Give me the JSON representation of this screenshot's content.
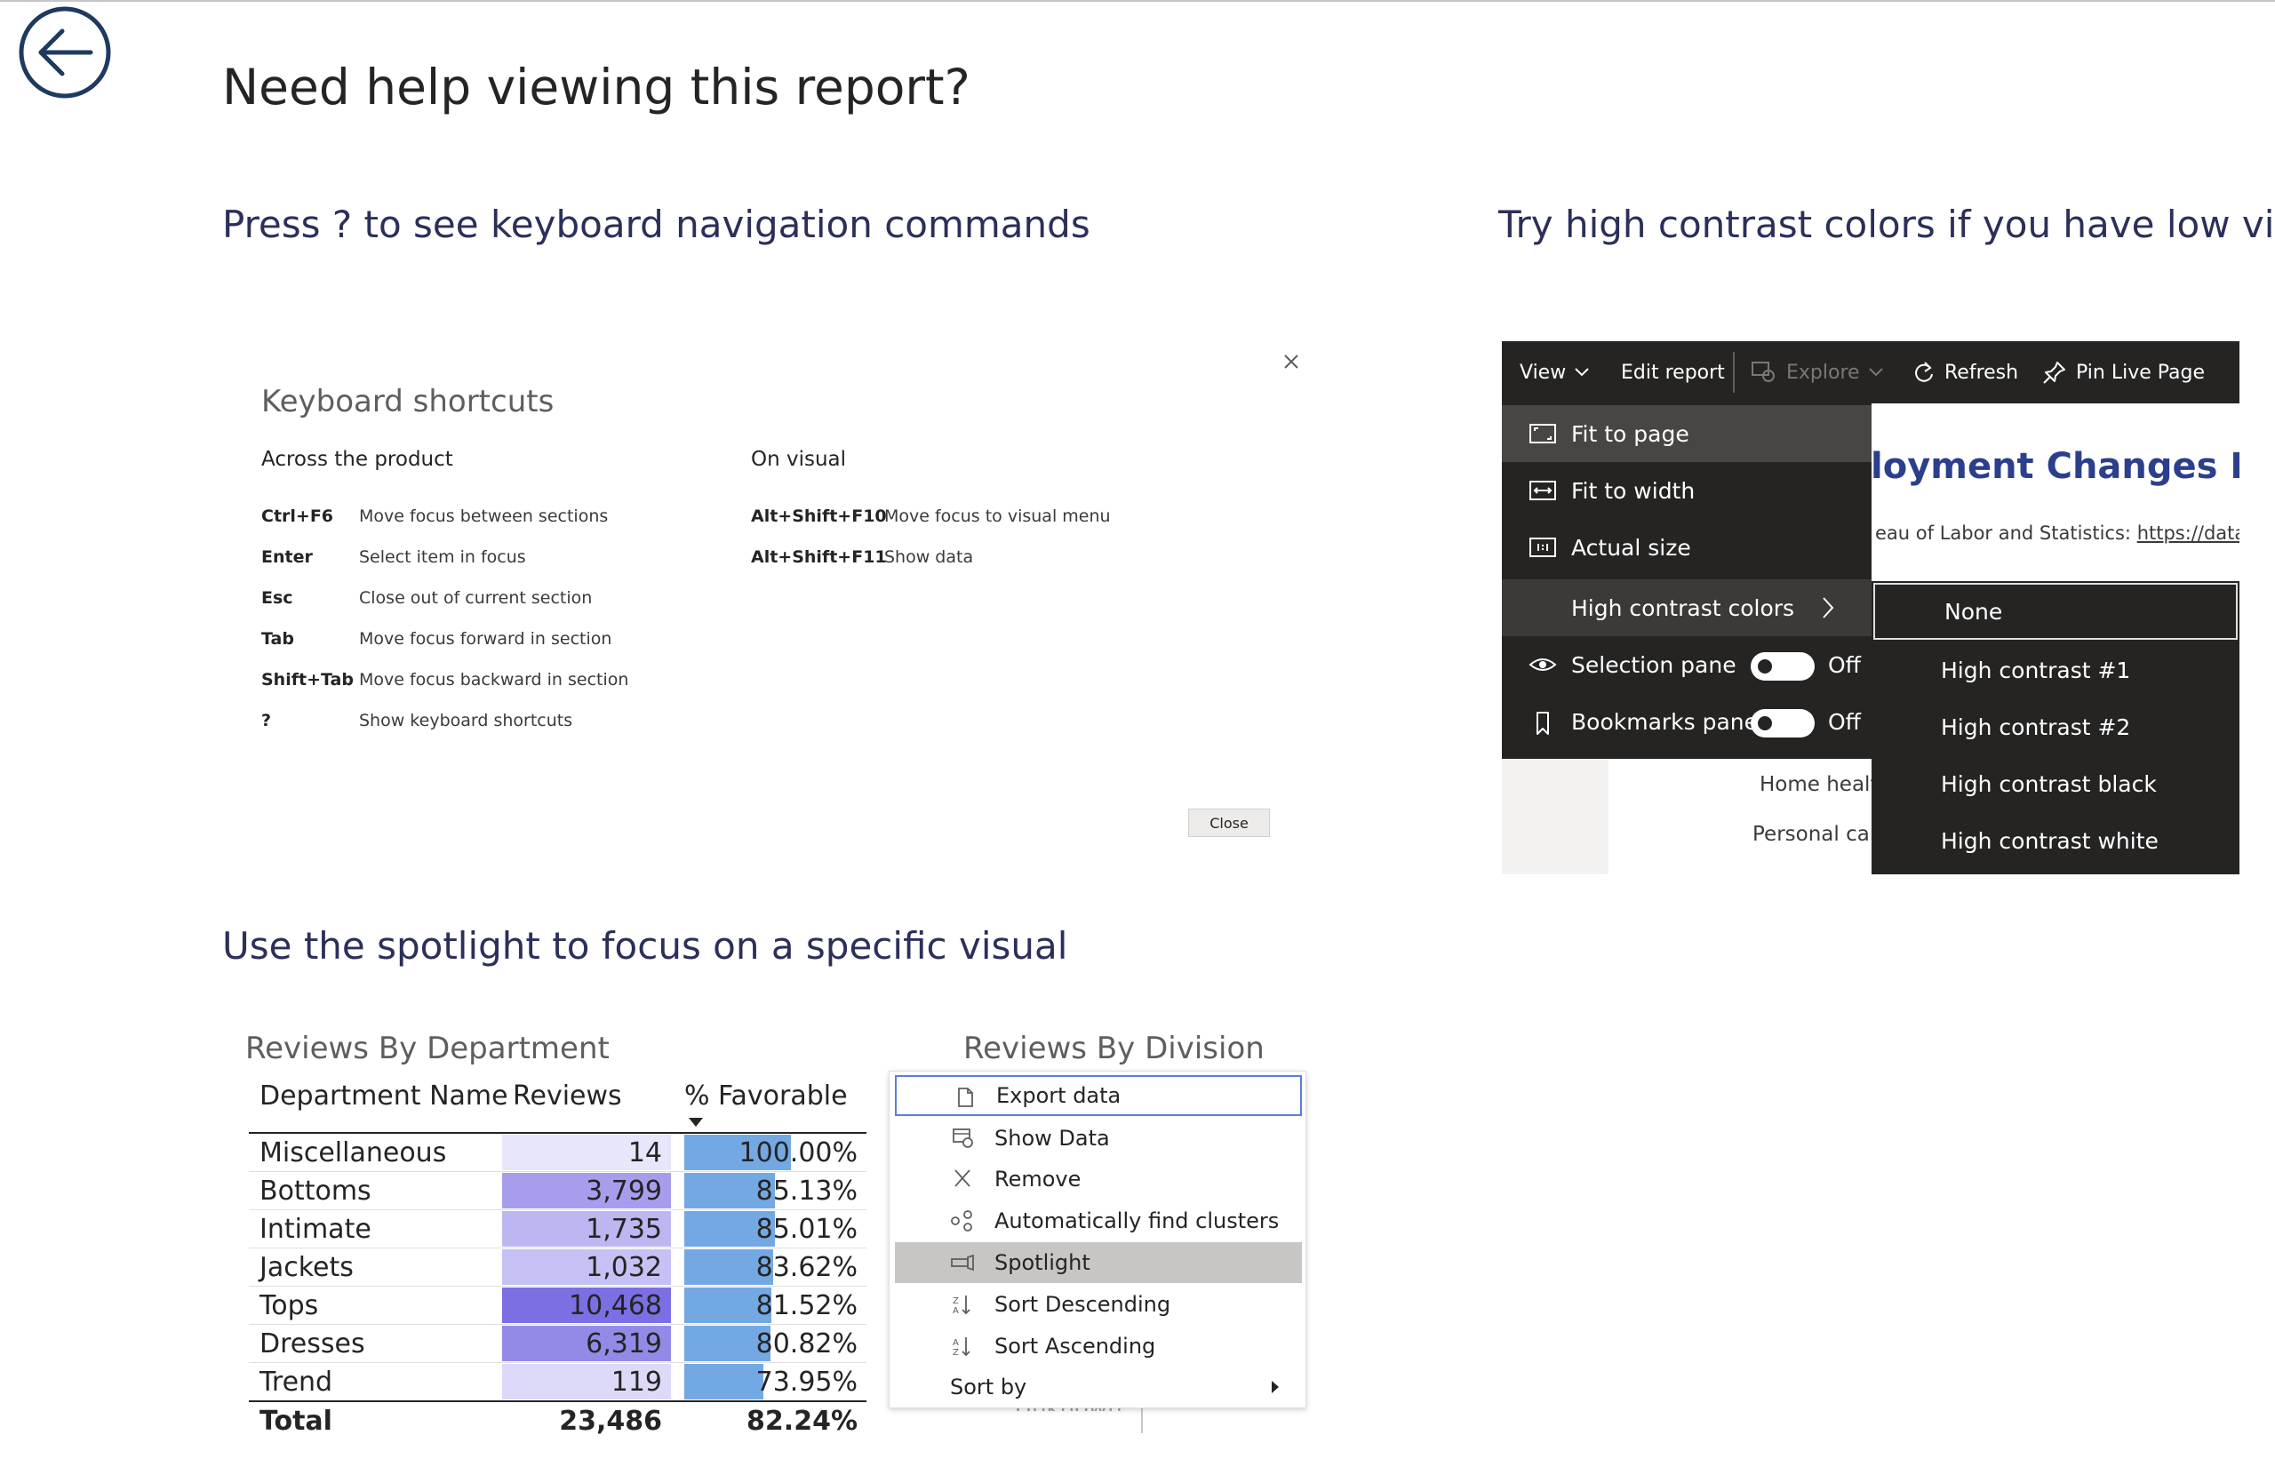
{
  "page": {
    "title": "Need help viewing this report?"
  },
  "sections": {
    "keyboard": "Press ? to see keyboard navigation commands",
    "contrast": "Try high contrast colors if you have low vision",
    "spotlight": "Use the spotlight to focus on a specific visual"
  },
  "keyboard_dialog": {
    "title": "Keyboard shortcuts",
    "col1_heading": "Across the product",
    "col2_heading": "On visual",
    "col1_rows": [
      {
        "key": "Ctrl+F6",
        "desc": "Move focus between sections"
      },
      {
        "key": "Enter",
        "desc": "Select item in focus"
      },
      {
        "key": "Esc",
        "desc": "Close out of current section"
      },
      {
        "key": "Tab",
        "desc": "Move focus forward in section"
      },
      {
        "key": "Shift+Tab",
        "desc": "Move focus backward in section"
      },
      {
        "key": "?",
        "desc": "Show keyboard shortcuts"
      }
    ],
    "col2_rows": [
      {
        "key": "Alt+Shift+F10",
        "desc": "Move focus to visual menu"
      },
      {
        "key": "Alt+Shift+F11",
        "desc": "Show data"
      }
    ],
    "close_label": "Close"
  },
  "contrast_demo": {
    "toolbar": {
      "view": "View",
      "edit_report": "Edit report",
      "explore": "Explore",
      "refresh": "Refresh",
      "pin": "Pin Live Page"
    },
    "report_title": "loyment Changes By (",
    "report_source_prefix": "eau of Labor and Statistics:",
    "report_source_link": "https://data",
    "report_rows": [
      "Home healt",
      "Personal car"
    ],
    "menu": {
      "fit_to_page": "Fit to page",
      "fit_to_width": "Fit to width",
      "actual_size": "Actual size",
      "high_contrast": "High contrast colors",
      "selection_pane": "Selection pane",
      "selection_state": "Off",
      "bookmarks_pane": "Bookmarks pane",
      "bookmarks_state": "Off"
    },
    "submenu": [
      "None",
      "High contrast #1",
      "High contrast #2",
      "High contrast black",
      "High contrast white"
    ]
  },
  "spotlight_demo": {
    "table_title": "Reviews By Department",
    "columns": [
      "Department Name",
      "Reviews",
      "% Favorable"
    ],
    "rows": [
      {
        "name": "Miscellaneous",
        "reviews": "14",
        "favorable": "100.00%"
      },
      {
        "name": "Bottoms",
        "reviews": "3,799",
        "favorable": "85.13%"
      },
      {
        "name": "Intimate",
        "reviews": "1,735",
        "favorable": "85.01%"
      },
      {
        "name": "Jackets",
        "reviews": "1,032",
        "favorable": "83.62%"
      },
      {
        "name": "Tops",
        "reviews": "10,468",
        "favorable": "81.52%"
      },
      {
        "name": "Dresses",
        "reviews": "6,319",
        "favorable": "80.82%"
      },
      {
        "name": "Trend",
        "reviews": "119",
        "favorable": "73.95%"
      }
    ],
    "total": {
      "label": "Total",
      "reviews": "23,486",
      "favorable": "82.24%"
    },
    "division_title": "Reviews By Division",
    "context_menu": [
      "Export data",
      "Show Data",
      "Remove",
      "Automatically find clusters",
      "Spotlight",
      "Sort Descending",
      "Sort Ascending",
      "Sort by"
    ],
    "under_text": "Unknown"
  },
  "colors": {
    "heading": "#2b2f5a",
    "toolbar_bg": "#252423",
    "bar_favorable": "#74a8e3",
    "review_low": "#e8e6fb",
    "review_high": "#7b6fe3",
    "focus_border": "#5b7ed9"
  }
}
